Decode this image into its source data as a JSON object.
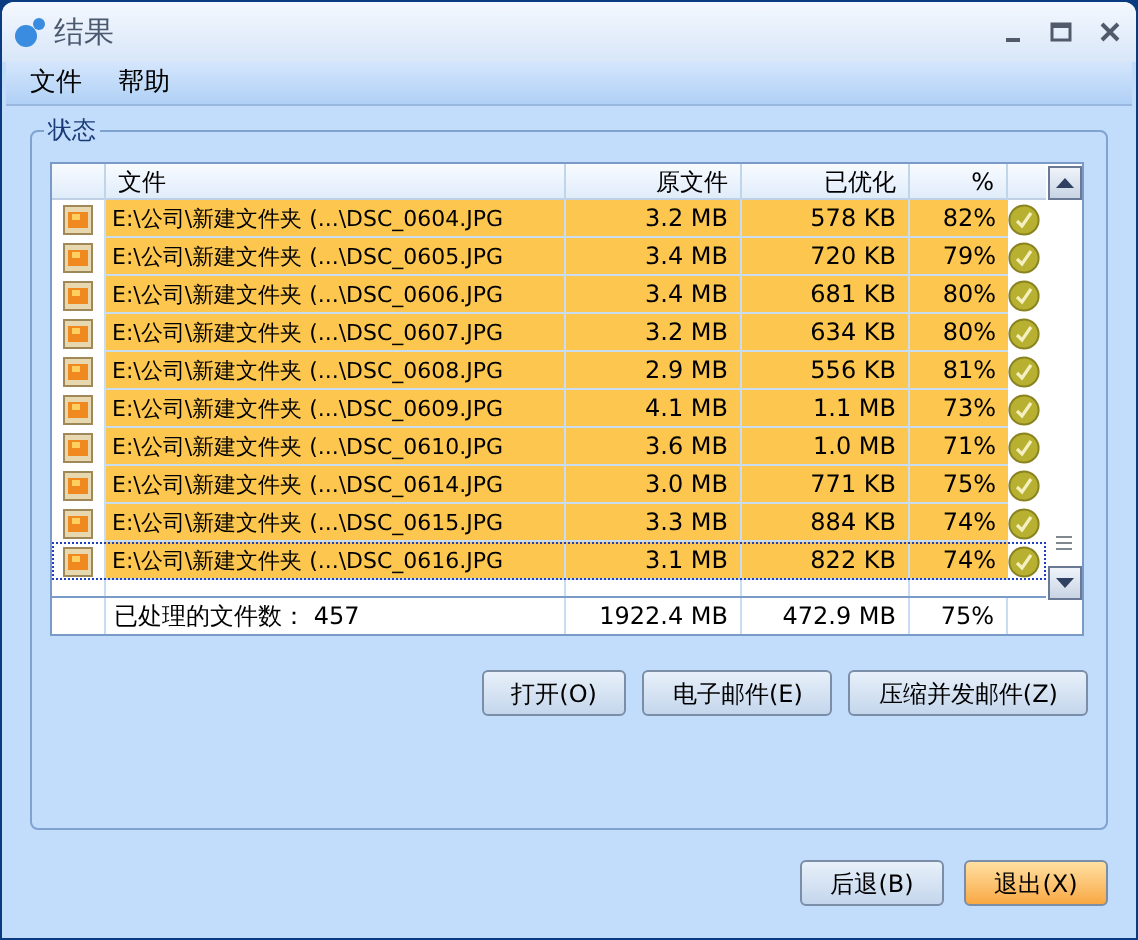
{
  "window": {
    "title": "结果"
  },
  "menu": [
    "文件",
    "帮助"
  ],
  "group": {
    "title": "状态"
  },
  "table": {
    "columns": [
      "文件",
      "原文件",
      "已优化",
      "%"
    ],
    "rows": [
      {
        "file": "E:\\公司\\新建文件夹 (...\\DSC_0604.JPG",
        "original": "3.2 MB",
        "optimized": "578 KB",
        "percent": "82%",
        "selected": true,
        "focused": false,
        "done": true
      },
      {
        "file": "E:\\公司\\新建文件夹 (...\\DSC_0605.JPG",
        "original": "3.4 MB",
        "optimized": "720 KB",
        "percent": "79%",
        "selected": true,
        "focused": false,
        "done": true
      },
      {
        "file": "E:\\公司\\新建文件夹 (...\\DSC_0606.JPG",
        "original": "3.4 MB",
        "optimized": "681 KB",
        "percent": "80%",
        "selected": true,
        "focused": false,
        "done": true
      },
      {
        "file": "E:\\公司\\新建文件夹 (...\\DSC_0607.JPG",
        "original": "3.2 MB",
        "optimized": "634 KB",
        "percent": "80%",
        "selected": true,
        "focused": false,
        "done": true
      },
      {
        "file": "E:\\公司\\新建文件夹 (...\\DSC_0608.JPG",
        "original": "2.9 MB",
        "optimized": "556 KB",
        "percent": "81%",
        "selected": true,
        "focused": false,
        "done": true
      },
      {
        "file": "E:\\公司\\新建文件夹 (...\\DSC_0609.JPG",
        "original": "4.1 MB",
        "optimized": "1.1 MB",
        "percent": "73%",
        "selected": true,
        "focused": false,
        "done": true
      },
      {
        "file": "E:\\公司\\新建文件夹 (...\\DSC_0610.JPG",
        "original": "3.6 MB",
        "optimized": "1.0 MB",
        "percent": "71%",
        "selected": true,
        "focused": false,
        "done": true
      },
      {
        "file": "E:\\公司\\新建文件夹 (...\\DSC_0614.JPG",
        "original": "3.0 MB",
        "optimized": "771 KB",
        "percent": "75%",
        "selected": true,
        "focused": false,
        "done": true
      },
      {
        "file": "E:\\公司\\新建文件夹 (...\\DSC_0615.JPG",
        "original": "3.3 MB",
        "optimized": "884 KB",
        "percent": "74%",
        "selected": true,
        "focused": false,
        "done": true
      },
      {
        "file": "E:\\公司\\新建文件夹 (...\\DSC_0616.JPG",
        "original": "3.1 MB",
        "optimized": "822 KB",
        "percent": "74%",
        "selected": true,
        "focused": true,
        "done": true
      }
    ],
    "total": {
      "file": "已处理的文件数： 457",
      "original": "1922.4 MB",
      "optimized": "472.9 MB",
      "percent": "75%"
    }
  },
  "actions": [
    "打开(O)",
    "电子邮件(E)",
    "压缩并发邮件(Z)"
  ],
  "footer_buttons": [
    {
      "label": "后退(B)",
      "default": false
    },
    {
      "label": "退出(X)",
      "default": true
    }
  ]
}
